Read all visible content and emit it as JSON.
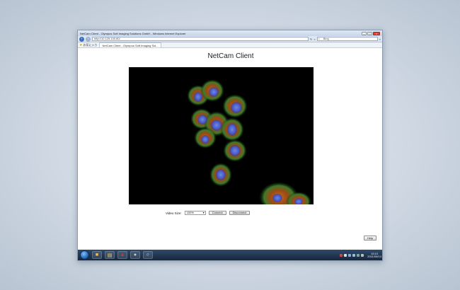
{
  "browser": {
    "window_title": "NetCam Client - Olympus Soft Imaging Solutions GmbH - Windows Internet Explorer",
    "address": "http://10.125.100.80/",
    "search_placeholder": "Bing",
    "favorites_label": "お気に入り",
    "tab_title": "NetCam Client - Olympus Soft Imaging Sol..."
  },
  "page": {
    "title": "NetCam Client",
    "video_size_label": "Video Size:",
    "video_size_value": "100%",
    "connect_label": "Connect",
    "disconnect_label": "Disconnect",
    "help_label": "Help"
  },
  "taskbar": {
    "clock_time": "15:10",
    "clock_date": "2011/06/14"
  },
  "colors": {
    "window_chrome": "#dde6f1",
    "taskbar": "#17263b",
    "video_bg": "#000000"
  }
}
